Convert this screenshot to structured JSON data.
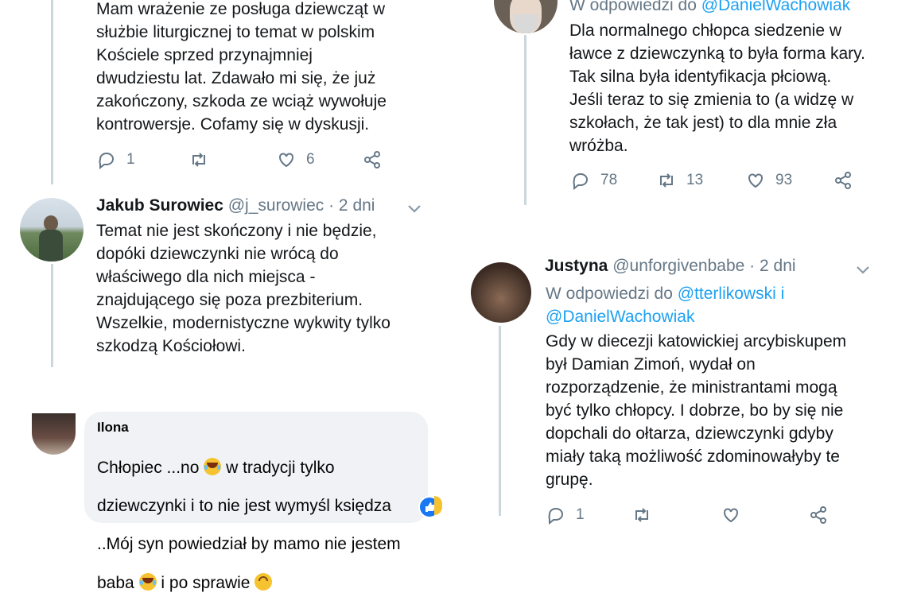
{
  "tweet1": {
    "text": "Mam wrażenie ze posługa dziewcząt w\nsłużbie liturgicznej to temat w polskim\nKościele sprzed przynajmniej\ndwudziestu lat. Zdawało mi się, że już\nzakończony, szkoda ze wciąż wywołuje\nkontrowersje. Cofamy się w dyskusji.",
    "reply_count": "1",
    "retweet_count": "",
    "like_count": "6"
  },
  "tweet2": {
    "name": "Jakub Surowiec",
    "handle": "@j_surowiec",
    "time": "· 2 dni",
    "text": "Temat nie jest skończony i nie będzie,\ndopóki dziewczynki nie wrócą do\nwłaściwego dla nich miejsca -\nznajdującego się poza prezbiterium.\nWszelkie, modernistyczne wykwity tylko\nszkodzą Kościołowi."
  },
  "fb_comment": {
    "name": "Ilona",
    "line1_a": "Chłopiec ...no ",
    "line1_b": " w tradycji tylko",
    "line2": "dziewczynki i to nie jest wymyśl księdza",
    "line3": "..Mój syn powiedział by mamo nie jestem",
    "line4_a": "baba ",
    "line4_b": " i po sprawie "
  },
  "tweet3": {
    "reply_prefix": "W odpowiedzi do ",
    "reply_mention": "@DanielWachowiak",
    "text": "Dla normalnego chłopca siedzenie w\nławce z dziewczynką to była forma kary.\nTak silna była identyfikacja płciową.\nJeśli teraz to się zmienia to (a widzę w\nszkołach, że tak jest) to dla mnie zła\nwróżba.",
    "reply_count": "78",
    "retweet_count": "13",
    "like_count": "93"
  },
  "tweet4": {
    "name": "Justyna",
    "handle": "@unforgivenbabe",
    "time": "· 2 dni",
    "reply_prefix": "W odpowiedzi do ",
    "reply_mention1": "@tterlikowski",
    "reply_and": " i",
    "reply_mention2": "@DanielWachowiak",
    "text": "Gdy w diecezji katowickiej arcybiskupem\nbył Damian Zimoń, wydał on\nrozporządzenie, że ministrantami mogą\nbyć tylko chłopcy. I dobrze, bo by się nie\ndopchali do ołtarza, dziewczynki gdyby\nmiały taką możliwość zdominowałyby te\ngrupę.",
    "reply_count": "1"
  },
  "icons": [
    "reply-icon",
    "retweet-icon",
    "like-icon",
    "share-icon",
    "chevron-down-icon",
    "facebook-like-reaction-icon",
    "laughing-emoji-icon",
    "upside-down-emoji-icon"
  ],
  "colors": {
    "link": "#1da1f2",
    "secondary": "#657786",
    "thread_line": "#ccd6dd",
    "fb_bubble": "#f0f2f5",
    "fb_like": "#1877f2"
  }
}
